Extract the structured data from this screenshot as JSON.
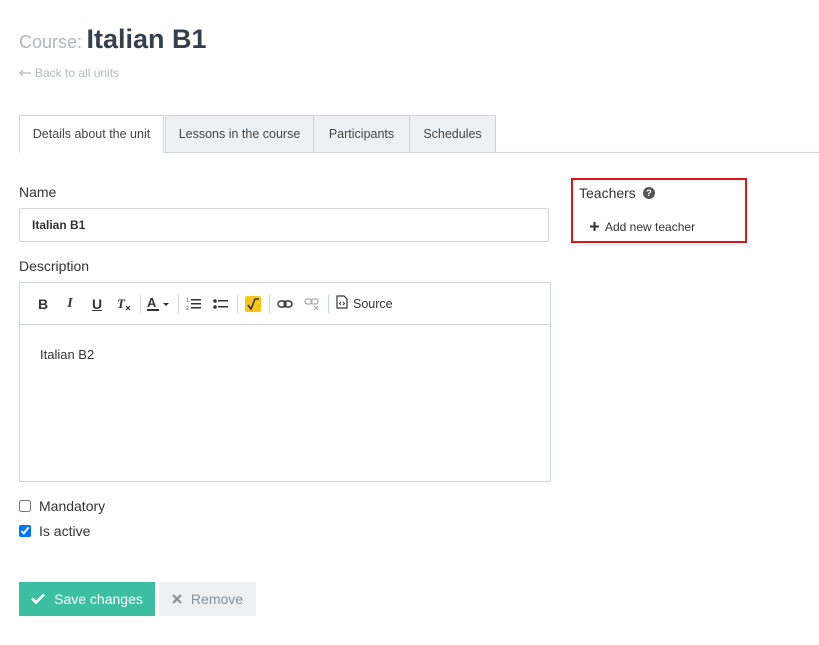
{
  "header": {
    "prefix": "Course:",
    "title": "Italian B1",
    "back_label": "Back to all units"
  },
  "tabs": [
    {
      "label": "Details about the unit",
      "active": true
    },
    {
      "label": "Lessons in the course",
      "active": false
    },
    {
      "label": "Participants",
      "active": false
    },
    {
      "label": "Schedules",
      "active": false
    }
  ],
  "form": {
    "name_label": "Name",
    "name_value": "Italian B1",
    "description_label": "Description",
    "description_value": "Italian B2",
    "toolbar": {
      "source_label": "Source"
    },
    "mandatory_label": "Mandatory",
    "mandatory_checked": false,
    "active_label": "Is active",
    "active_checked": true
  },
  "actions": {
    "save_label": "Save changes",
    "remove_label": "Remove"
  },
  "teachers": {
    "title": "Teachers",
    "add_label": "Add new teacher"
  },
  "colors": {
    "accent": "#3cbfa0",
    "highlight_border": "#e0131a",
    "title": "#34404d"
  }
}
